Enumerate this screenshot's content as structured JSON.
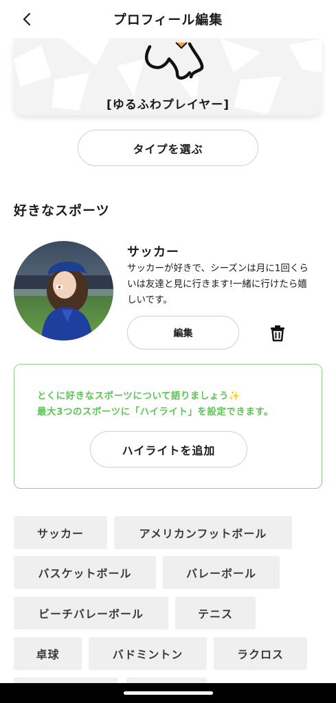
{
  "header": {
    "title": "プロフィール編集",
    "back_icon": "chevron-left-icon"
  },
  "type_card": {
    "name": "[ゆるふわプレイヤー]"
  },
  "type_button": {
    "label": "タイプを選ぶ"
  },
  "favorite_sports": {
    "title": "好きなスポーツ",
    "item": {
      "name": "サッカー",
      "description": "サッカーが好きで、シーズンは月に1回くらいは友達と見に行きます!一緒に行けたら嬉しいです。",
      "edit_label": "編集",
      "delete_icon": "trash-icon"
    }
  },
  "highlight": {
    "line1": "とくに好きなスポーツについて語りましょう✨",
    "line2": "最大3つのスポーツに「ハイライト」を設定できます。",
    "button_label": "ハイライトを追加",
    "accent_color": "#5cc455"
  },
  "sport_chips": [
    "サッカー",
    "アメリカンフットボール",
    "バスケットボール",
    "バレーボール",
    "ビーチバレーボール",
    "テニス",
    "卓球",
    "バドミントン",
    "ラクロス"
  ]
}
